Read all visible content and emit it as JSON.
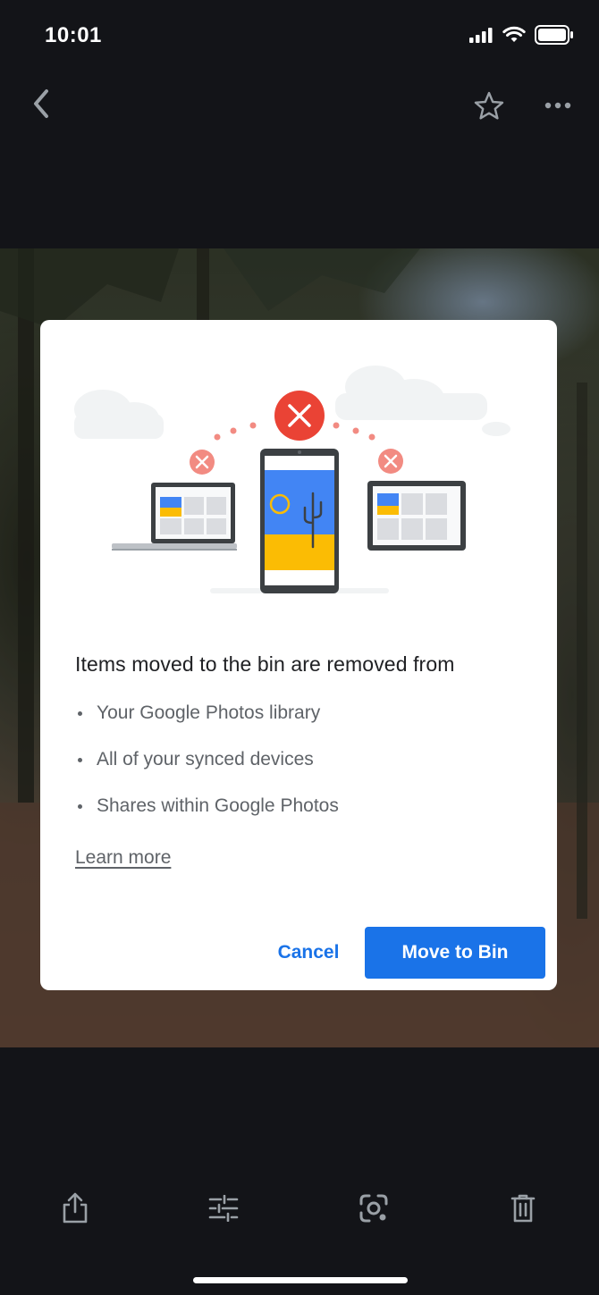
{
  "status_bar": {
    "time": "10:01",
    "icons": [
      "signal-icon",
      "wifi-icon",
      "battery-icon"
    ]
  },
  "top_bar": {
    "icons": [
      "back-arrow-icon",
      "star-icon",
      "more-options-icon"
    ]
  },
  "dialog": {
    "heading": "Items moved to the bin are removed from",
    "bullets": [
      "Your Google Photos library",
      "All of your synced devices",
      "Shares within Google Photos"
    ],
    "learn_more": "Learn more",
    "cancel_label": "Cancel",
    "confirm_label": "Move to Bin"
  },
  "bottom_toolbar": {
    "icons": [
      "share-icon",
      "edit-adjust-icon",
      "lens-icon",
      "delete-icon"
    ]
  },
  "colors": {
    "accent": "#1a73e8",
    "delete_red": "#ea4335",
    "photo_blue": "#4285f4",
    "photo_yellow": "#fbbc04"
  }
}
